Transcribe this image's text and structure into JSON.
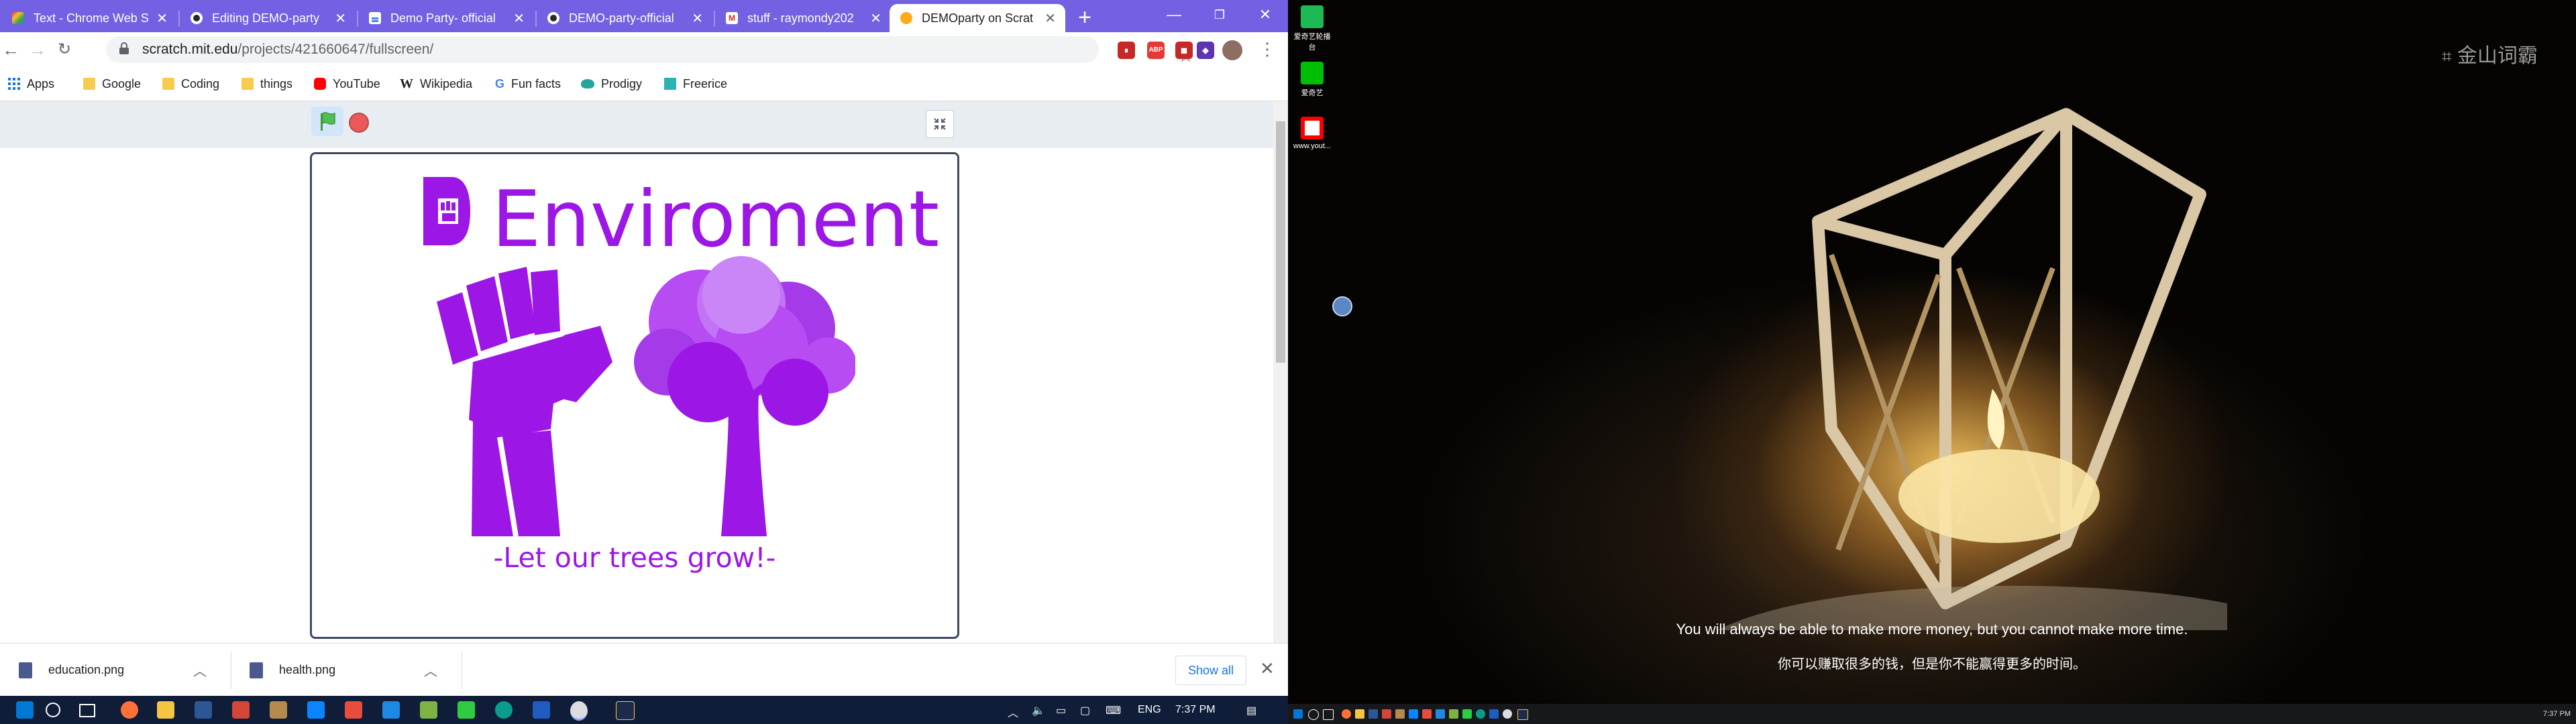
{
  "browser": {
    "tabs": [
      {
        "title": "Text - Chrome Web S",
        "icon": "rainbow-icon",
        "active": false
      },
      {
        "title": "Editing DEMO-party",
        "icon": "github-icon",
        "active": false
      },
      {
        "title": "Demo Party- official",
        "icon": "docs-icon",
        "active": false
      },
      {
        "title": "DEMO-party-official",
        "icon": "github-icon",
        "active": false
      },
      {
        "title": "stuff - raymondy202",
        "icon": "gmail-icon",
        "active": false
      },
      {
        "title": "DEMOparty on Scrat",
        "icon": "scratch-icon",
        "active": true
      }
    ],
    "url_host": "scratch.mit.edu",
    "url_path": "/projects/421660647/fullscreen/",
    "bookmarks": [
      "Apps",
      "Google",
      "Coding",
      "things",
      "YouTube",
      "Wikipedia",
      "Fun facts",
      "Prodigy",
      "Freerice"
    ],
    "extensions": [
      "ABP"
    ]
  },
  "scratch": {
    "title": "Enviroment",
    "subtitle": "-Let our trees grow!-"
  },
  "downloads": {
    "items": [
      "education.png",
      "health.png"
    ],
    "show_all": "Show all"
  },
  "taskbar_left": {
    "lang": "ENG",
    "time": "7:37 PM"
  },
  "desktop_right": {
    "icons": [
      "爱奇艺轮播台",
      "爱奇艺",
      "www.yout..."
    ],
    "watermark": "金山词霸",
    "quote_en": "You will always be able to make more money, but you cannot make more time.",
    "quote_zh": "你可以赚取很多的钱，但是你不能赢得更多的时间。",
    "time": "7:37 PM"
  },
  "colors": {
    "tabbar": "#7261e2",
    "scratch_purple": "#9c17e6",
    "taskbar": "#0f1d38"
  }
}
